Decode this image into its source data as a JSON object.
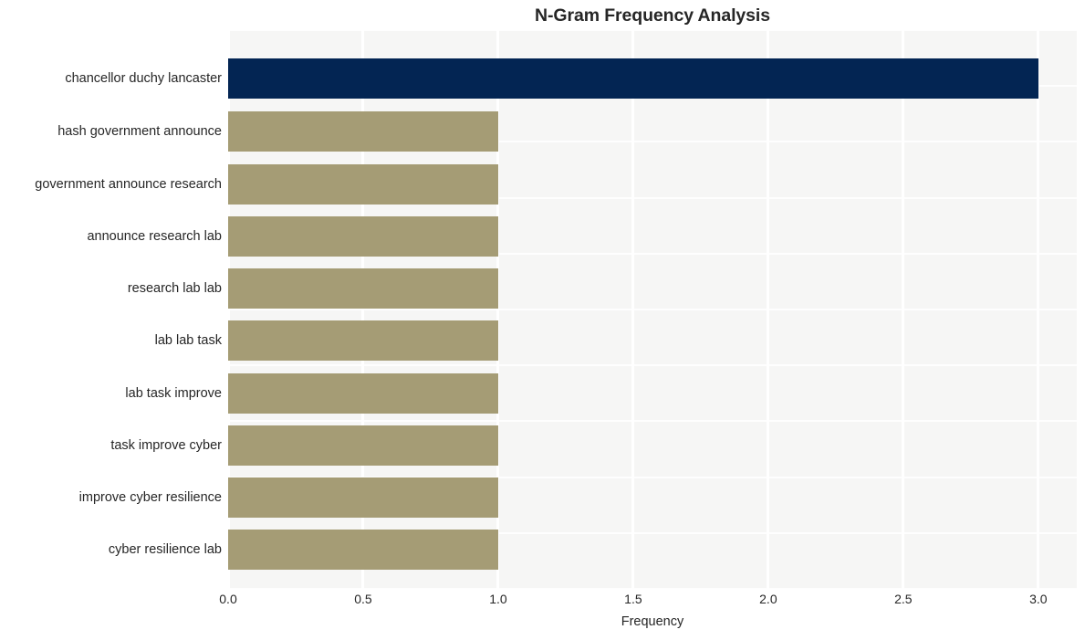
{
  "chart_data": {
    "type": "bar",
    "orientation": "horizontal",
    "title": "N-Gram Frequency Analysis",
    "xlabel": "Frequency",
    "ylabel": "",
    "categories": [
      "chancellor duchy lancaster",
      "hash government announce",
      "government announce research",
      "announce research lab",
      "research lab lab",
      "lab lab task",
      "lab task improve",
      "task improve cyber",
      "improve cyber resilience",
      "cyber resilience lab"
    ],
    "values": [
      3.0,
      1.0,
      1.0,
      1.0,
      1.0,
      1.0,
      1.0,
      1.0,
      1.0,
      1.0
    ],
    "bar_colors": [
      "#032553",
      "#a59c75",
      "#a59c75",
      "#a59c75",
      "#a59c75",
      "#a59c75",
      "#a59c75",
      "#a59c75",
      "#a59c75",
      "#a59c75"
    ],
    "xlim": [
      0.0,
      3.1425
    ],
    "xticks": [
      0.0,
      0.5,
      1.0,
      1.5,
      2.0,
      2.5,
      3.0
    ],
    "xtick_labels": [
      "0.0",
      "0.5",
      "1.0",
      "1.5",
      "2.0",
      "2.5",
      "3.0"
    ],
    "grid": true,
    "grid_color": "#ffffff",
    "plot_background": "#f6f6f5",
    "figure_background": "#ffffff",
    "legend": null,
    "legend_position": "none"
  }
}
